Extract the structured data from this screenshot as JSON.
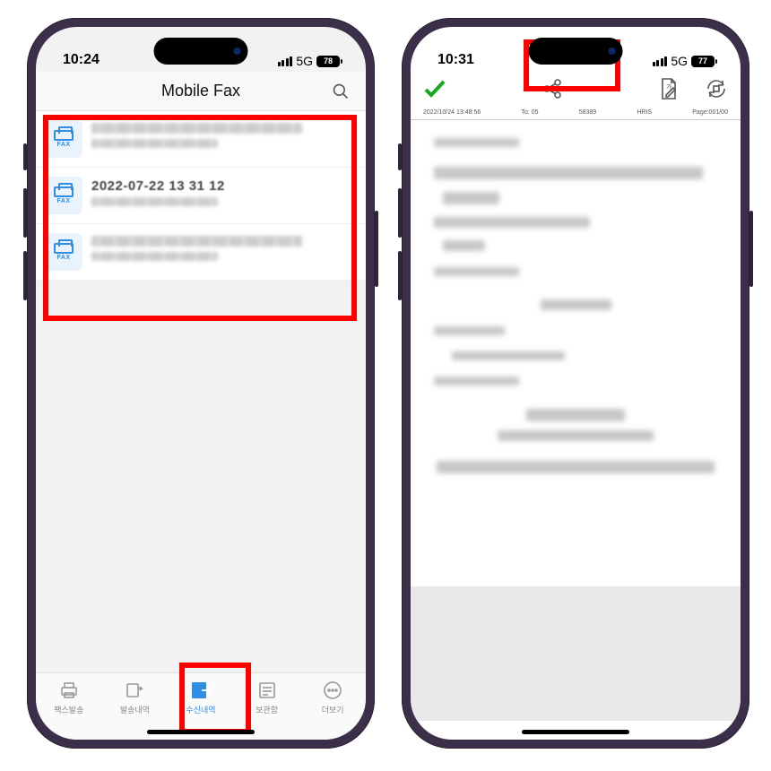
{
  "left": {
    "status": {
      "time": "10:24",
      "net": "5G",
      "battery": "78"
    },
    "title": "Mobile Fax",
    "faxIconLabel": "FAX",
    "rows": [
      {
        "line1_readable": null,
        "line2_readable": null
      },
      {
        "line1_readable": "2022-07-22 13 31 12",
        "line2_readable": null
      },
      {
        "line1_readable": null,
        "line2_readable": null
      }
    ],
    "tabs": [
      {
        "id": "send",
        "label": "팩스발송"
      },
      {
        "id": "sent",
        "label": "발송내역"
      },
      {
        "id": "recv",
        "label": "수신내역",
        "active": true
      },
      {
        "id": "box",
        "label": "보관함"
      },
      {
        "id": "more",
        "label": "더보기"
      }
    ]
  },
  "right": {
    "status": {
      "time": "10:31",
      "net": "5G",
      "battery": "77"
    },
    "docmeta": {
      "date": "2022/10/24 13:48:56",
      "to": "To: 05",
      "id": "58389",
      "sys": "HRIS",
      "page": "Page:001/00"
    }
  }
}
